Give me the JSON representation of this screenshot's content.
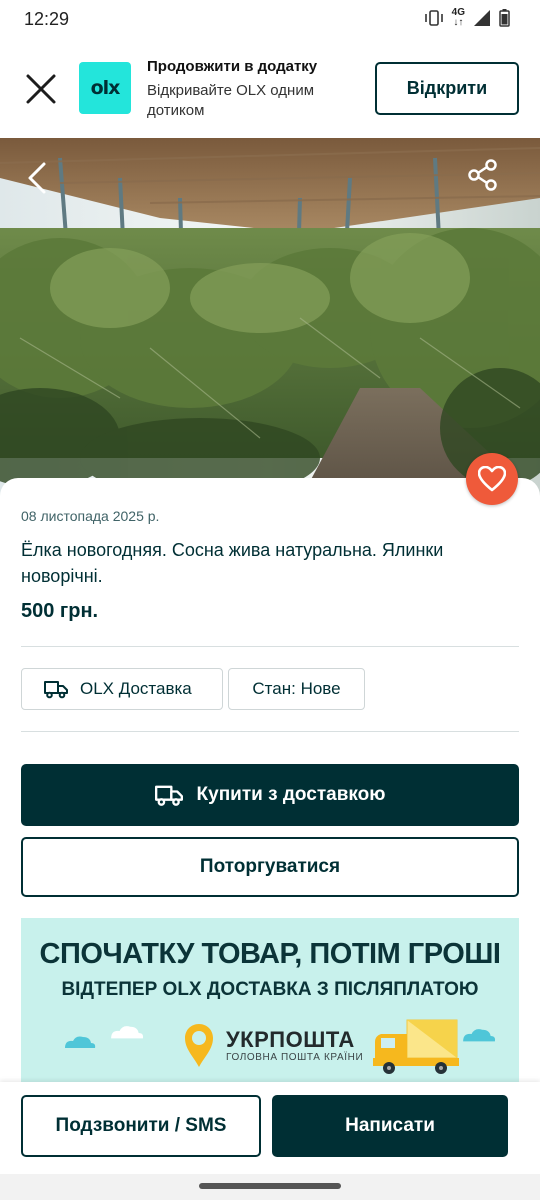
{
  "status_bar": {
    "time": "12:29",
    "network": "4G",
    "icons": [
      "vibrate-icon",
      "signal-icon",
      "battery-icon"
    ]
  },
  "app_banner": {
    "title": "Продовжити в додатку",
    "subtitle": "Відкривайте OLX одним дотиком",
    "open_label": "Відкрити",
    "logo_text": "olx"
  },
  "listing": {
    "date": "08 листопада 2025 р.",
    "title": "Ёлка новогодняя. Сосна жива натуральна. Ялинки новорічні.",
    "price": "500 грн.",
    "chips": {
      "delivery": "OLX Доставка",
      "condition": "Стан: Нове"
    }
  },
  "actions": {
    "buy_label": "Купити з доставкою",
    "haggle_label": "Поторгуватися"
  },
  "promo": {
    "headline": "СПОЧАТКУ ТОВАР, ПОТІМ ГРОШІ",
    "subheadline": "ВІДТЕПЕР OLX ДОСТАВКА З ПІСЛЯПЛАТОЮ",
    "brand": "УКРПОШТА",
    "brand_tagline": "ГОЛОВНА ПОШТА КРАЇНИ"
  },
  "bottom_bar": {
    "call_label": "Подзвонити / SMS",
    "message_label": "Написати"
  },
  "colors": {
    "primary_dark": "#002f34",
    "olx_teal": "#23e5db",
    "favorite_orange": "#ef5a3a",
    "promo_bg": "#c8f1ec",
    "ukrposhta_yellow": "#f6b81e"
  }
}
